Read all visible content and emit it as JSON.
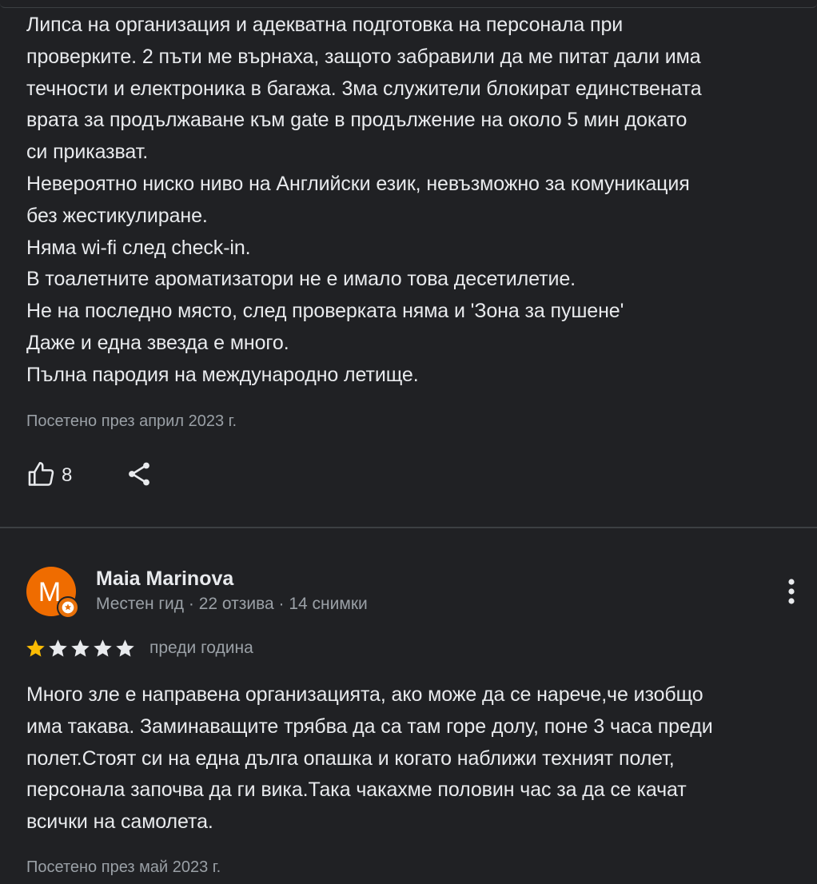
{
  "review1": {
    "lines": [
      "Липса на организация и адекватна подготовка на персонала при",
      "проверките. 2 пъти ме върнаха, защото забравили да ме питат дали има",
      "течности и електроника в багажа. 3ма служители блокират единствената",
      "врата за продължаване към gate в продължение на около 5 мин докато",
      "си приказват.",
      "Невероятно ниско ниво на Английски език, невъзможно за комуникация",
      "без жестикулиране.",
      "Няма wi-fi след check-in.",
      "В тоалетните ароматизатори не е имало това десетилетие.",
      "Не на последно място, след проверката няма и 'Зона за пушене'",
      "Даже и една звезда е много.",
      "Пълна пародия на международно летище."
    ],
    "visited": "Посетено през април 2023 г.",
    "likes": "8",
    "like_icon": "thumb-up-icon",
    "share_icon": "share-icon"
  },
  "review2": {
    "author_initial": "M",
    "author_name": "Maia Marinova",
    "author_meta": "Местен гид · 22 отзива · 14 снимки",
    "badge_icon": "local-guide-star-icon",
    "more_icon": "more-vert-icon",
    "rating": 1,
    "max_rating": 5,
    "time_ago": "преди година",
    "lines": [
      "Много зле е направена организацията, ако може да се нарече,че изобщо",
      "има такава. Заминаващите трябва да са там горе долу, поне 3 часа преди",
      "полет.Стоят си на една дълга опашка и когато наближи техният полет,",
      "персонала започва да ги вика.Така чакахме половин час за да се качат",
      "всички на самолета."
    ],
    "visited": "Посетено през май 2023 г."
  },
  "colors": {
    "background": "#202124",
    "text": "#e8eaed",
    "muted": "#9aa0a6",
    "star_filled": "#fbbc04",
    "star_empty": "#e8eaed",
    "avatar": "#ef6c00"
  }
}
